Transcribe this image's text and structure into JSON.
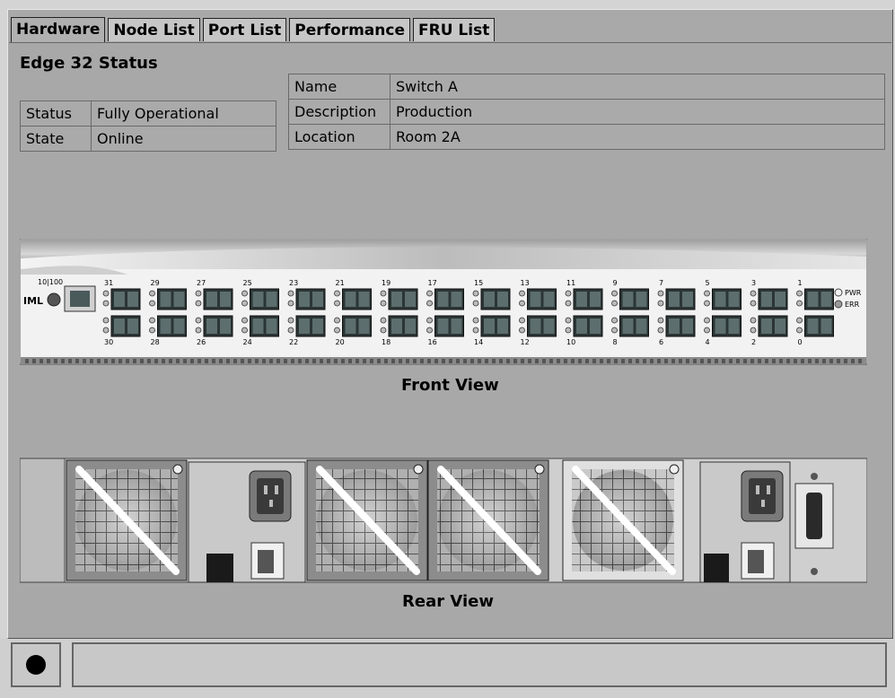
{
  "tabs": [
    {
      "label": "Hardware"
    },
    {
      "label": "Node List"
    },
    {
      "label": "Port List"
    },
    {
      "label": "Performance"
    },
    {
      "label": "FRU List"
    }
  ],
  "status_title": "Edge 32 Status",
  "status_table": [
    {
      "key": "Status",
      "value": "Fully Operational"
    },
    {
      "key": "State",
      "value": "Online"
    }
  ],
  "info_table": [
    {
      "key": "Name",
      "value": "Switch A"
    },
    {
      "key": "Description",
      "value": "Production"
    },
    {
      "key": "Location",
      "value": "Room 2A"
    }
  ],
  "front_view_label": "Front View",
  "rear_view_label": "Rear View",
  "front_panel": {
    "mgmt_label": "10|100",
    "iml_label": "IML",
    "top_port_numbers": [
      "31",
      "29",
      "27",
      "25",
      "23",
      "21",
      "19",
      "17",
      "15",
      "13",
      "11",
      "9",
      "7",
      "5",
      "3",
      "1"
    ],
    "bottom_port_numbers": [
      "30",
      "28",
      "26",
      "24",
      "22",
      "20",
      "18",
      "16",
      "14",
      "12",
      "10",
      "8",
      "6",
      "4",
      "2",
      "0"
    ],
    "pwr_label": "PWR",
    "err_label": "ERR"
  },
  "statusbar": {
    "message": ""
  }
}
